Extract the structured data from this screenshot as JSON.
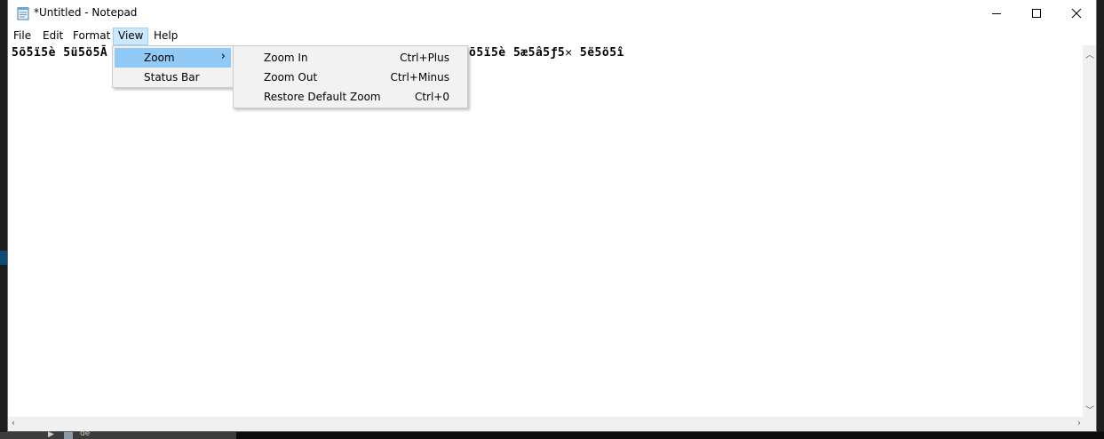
{
  "window": {
    "title": "*Untitled - Notepad",
    "controls": {
      "minimize": "—",
      "maximize": "☐",
      "close": "✕"
    }
  },
  "menubar": [
    "File",
    "Edit",
    "Format",
    "View",
    "Help"
  ],
  "active_menu": "View",
  "view_menu": {
    "items": [
      {
        "label": "Zoom",
        "has_submenu": true,
        "submenu_arrow": "›"
      },
      {
        "label": "Status Bar"
      }
    ]
  },
  "zoom_submenu": {
    "items": [
      {
        "label": "Zoom In",
        "shortcut": "Ctrl+Plus"
      },
      {
        "label": "Zoom Out",
        "shortcut": "Ctrl+Minus"
      },
      {
        "label": "Restore Default Zoom",
        "shortcut": "Ctrl+0"
      }
    ]
  },
  "editor": {
    "text_start": "5ṏ5ï5è 5ü5ö5Ā",
    "text_end": "ō5ï5è 5æ5â5ƒ5✕ 5ë5ö5î"
  },
  "background": {
    "taskbar_label": "de",
    "taskbar_arrow": "▶"
  },
  "colors": {
    "highlight": "#91c9f7",
    "menu_active": "#cce8ff",
    "menu_bg": "#f2f2f2"
  }
}
